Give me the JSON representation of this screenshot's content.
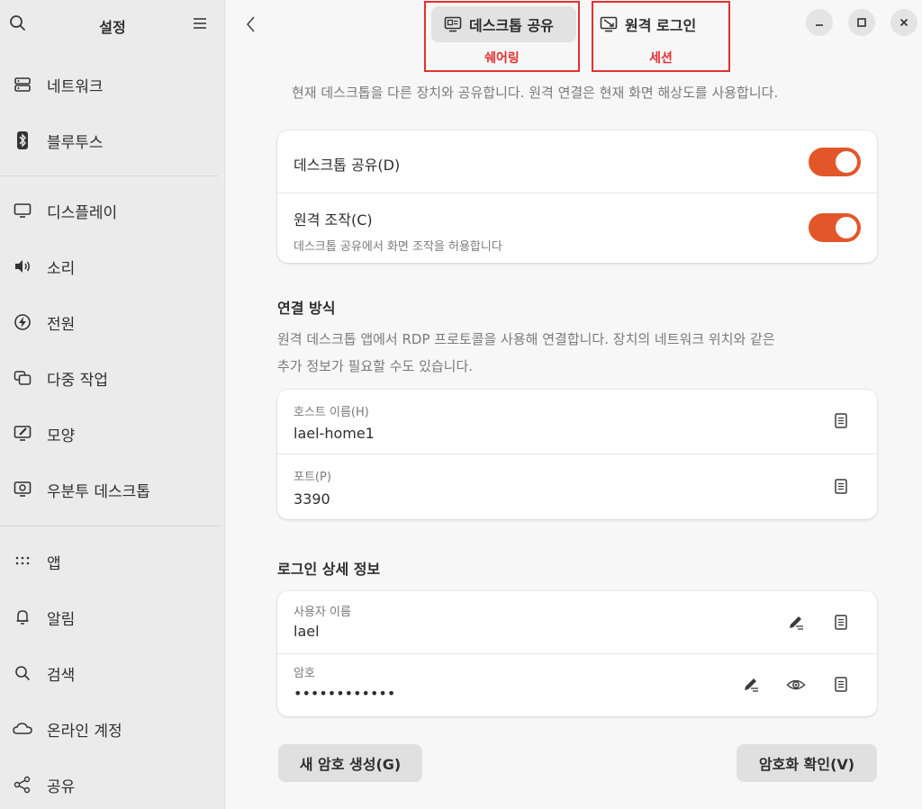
{
  "sidebar": {
    "title": "설정",
    "items": [
      {
        "label": "네트워크",
        "icon": "network-icon"
      },
      {
        "label": "블루투스",
        "icon": "bluetooth-icon"
      },
      {
        "label": "디스플레이",
        "icon": "display-icon"
      },
      {
        "label": "소리",
        "icon": "sound-icon"
      },
      {
        "label": "전원",
        "icon": "power-icon"
      },
      {
        "label": "다중 작업",
        "icon": "multitasking-icon"
      },
      {
        "label": "모양",
        "icon": "appearance-icon"
      },
      {
        "label": "우분투 데스크톱",
        "icon": "ubuntu-desktop-icon"
      },
      {
        "label": "앱",
        "icon": "apps-icon"
      },
      {
        "label": "알림",
        "icon": "notifications-icon"
      },
      {
        "label": "검색",
        "icon": "search-icon"
      },
      {
        "label": "온라인 계정",
        "icon": "online-accounts-icon"
      },
      {
        "label": "공유",
        "icon": "sharing-icon"
      }
    ]
  },
  "header": {
    "tabs": [
      {
        "label": "데스크톱 공유",
        "annotation": "쉐어링",
        "active": true
      },
      {
        "label": "원격 로그인",
        "annotation": "세션",
        "active": false
      }
    ]
  },
  "main": {
    "description": "현재 데스크톱을 다른 장치와 공유합니다. 원격 연결은 현재 화면 해상도를 사용합니다.",
    "toggles": [
      {
        "title": "데스크톱 공유(D)",
        "subtitle": "",
        "on": true
      },
      {
        "title": "원격 조작(C)",
        "subtitle": "데스크톱 공유에서 화면 조작을 허용합니다",
        "on": true
      }
    ],
    "connection": {
      "title": "연결 방식",
      "description_line1": "원격 데스크톱 앱에서 RDP 프로토콜을 사용해 연결합니다. 장치의 네트워크 위치와 같은",
      "description_line2": "추가 정보가 필요할 수도 있습니다.",
      "hostname_caption": "호스트 이름(H)",
      "hostname_value": "lael-home1",
      "port_caption": "포트(P)",
      "port_value": "3390"
    },
    "login": {
      "title": "로그인 상세 정보",
      "username_caption": "사용자 이름",
      "username_value": "lael",
      "password_caption": "암호",
      "password_value": "••••••••••••"
    },
    "buttons": {
      "generate_password": "새 암호 생성(G)",
      "verify_encryption": "암호화 확인(V)"
    }
  },
  "colors": {
    "accent": "#e2562a",
    "annotation": "#e53030"
  }
}
